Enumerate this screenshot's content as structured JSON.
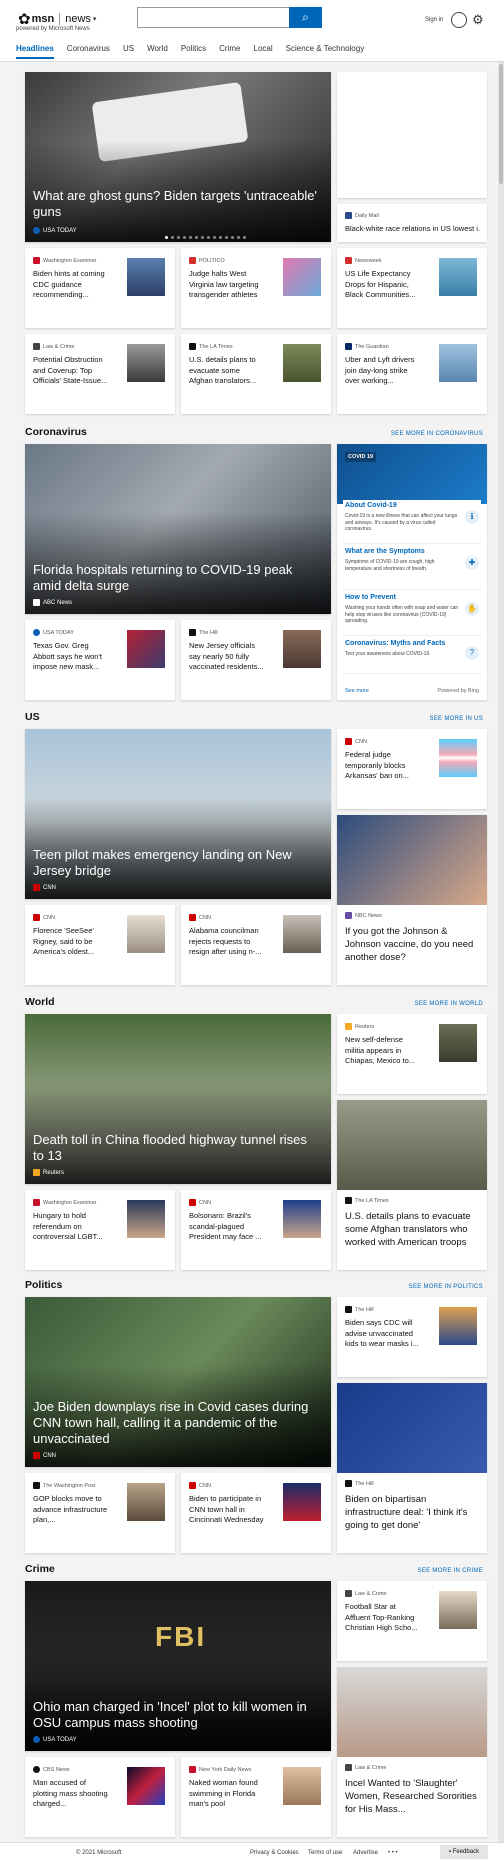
{
  "header": {
    "brand": "msn",
    "product": "news",
    "powered_by": "powered by Microsoft News",
    "search_placeholder": "",
    "sign_in": "Sign in"
  },
  "nav": [
    "Headlines",
    "Coronavirus",
    "US",
    "World",
    "Politics",
    "Crime",
    "Local",
    "Science & Technology"
  ],
  "top": {
    "hero": {
      "title": "What are ghost guns? Biden targets 'untraceable' guns",
      "source": "USA TODAY"
    },
    "side": {
      "source": "Daily Mail",
      "title": "Black-white race relations in US lowest i..."
    },
    "cards": [
      {
        "source": "Washington Examiner",
        "title": "Biden hints at coming CDC guidance recommending..."
      },
      {
        "source": "POLITICO",
        "title": "Judge halts West Virginia law targeting transgender athletes"
      },
      {
        "source": "Newsweek",
        "title": "US Life Expectancy Drops for Hispanic, Black Communities..."
      },
      {
        "source": "Law & Crime",
        "title": "Potential Obstruction and Coverup: Top Officials' State-Issue..."
      },
      {
        "source": "The LA Times",
        "title": "U.S. details plans to evacuate some Afghan translators..."
      },
      {
        "source": "The Guardian",
        "title": "Uber and Lyft drivers join day-long strike over working..."
      }
    ]
  },
  "coronavirus": {
    "heading": "Coronavirus",
    "more": "SEE MORE IN CORONAVIRUS",
    "hero": {
      "title": "Florida hospitals returning to COVID-19 peak amid delta surge",
      "source": "ABC News"
    },
    "cards": [
      {
        "source": "USA TODAY",
        "title": "Texas Gov. Greg Abbott says he won't impose new mask..."
      },
      {
        "source": "The Hill",
        "title": "New Jersey officials say nearly 50 fully vaccinated residents..."
      }
    ],
    "panel": {
      "label": "COVID 19",
      "items": [
        {
          "h": "About Covid-19",
          "d": "Covid-19 is a new illness that can affect your lungs and airways. It's caused by a virus called coronavirus."
        },
        {
          "h": "What are the Symptoms",
          "d": "Symptoms of COVID-19 are cough, high temperature and shortness of breath."
        },
        {
          "h": "How to Prevent",
          "d": "Washing your hands often with soap and water can help stop viruses like coronavirus (COVID-19) spreading."
        },
        {
          "h": "Coronavirus: Myths and Facts",
          "d": "Test your awareness about COVID-19."
        }
      ],
      "see_more": "See more",
      "powered": "Powered by Bing"
    }
  },
  "us": {
    "heading": "US",
    "more": "SEE MORE IN US",
    "hero": {
      "title": "Teen pilot makes emergency landing on New Jersey bridge",
      "source": "CNN"
    },
    "side": {
      "source": "CNN",
      "title": "Federal judge temporarily blocks Arkansas' ban on..."
    },
    "cards": [
      {
        "source": "CNN",
        "title": "Florence 'SeeSee' Rigney, said to be America's oldest..."
      },
      {
        "source": "CNN",
        "title": "Alabama councilman rejects requests to resign after using n-..."
      }
    ],
    "tall": {
      "source": "NBC News",
      "title": "If you got the Johnson & Johnson vaccine, do you need another dose?"
    }
  },
  "world": {
    "heading": "World",
    "more": "SEE MORE IN WORLD",
    "hero": {
      "title": "Death toll in China flooded highway tunnel rises to 13",
      "source": "Reuters"
    },
    "side": {
      "source": "Reuters",
      "title": "New self-defense militia appears in Chiapas, Mexico to..."
    },
    "cards": [
      {
        "source": "Washington Examiner",
        "title": "Hungary to hold referendum on controversial LGBT..."
      },
      {
        "source": "CNN",
        "title": "Bolsonaro: Brazil's scandal-plagued President may face ..."
      }
    ],
    "tall": {
      "source": "The LA Times",
      "title": "U.S. details plans to evacuate some Afghan translators who worked with American troops"
    }
  },
  "politics": {
    "heading": "Politics",
    "more": "SEE MORE IN POLITICS",
    "hero": {
      "title": "Joe Biden downplays rise in Covid cases during CNN town hall, calling it a pandemic of the unvaccinated",
      "source": "CNN"
    },
    "side": {
      "source": "The Hill",
      "title": "Biden says CDC will advise unvaccinated kids to wear masks i..."
    },
    "cards": [
      {
        "source": "The Washington Post",
        "title": "GOP blocks move to advance infrastructure plan,..."
      },
      {
        "source": "CNN",
        "title": "Biden to participate in CNN town hall in Cincinnati Wednesday"
      }
    ],
    "tall": {
      "source": "The Hill",
      "title": "Biden on bipartisan infrastructure deal: 'I think it's going to get done'"
    }
  },
  "crime": {
    "heading": "Crime",
    "more": "SEE MORE IN CRIME",
    "hero": {
      "title": "Ohio man charged in 'Incel' plot to kill women in OSU campus mass shooting",
      "source": "USA TODAY"
    },
    "side": {
      "source": "Law & Crime",
      "title": "Football Star at Affluent Top-Ranking Christian High Scho..."
    },
    "cards": [
      {
        "source": "CBS News",
        "title": "Man accused of plotting mass shooting charged..."
      },
      {
        "source": "New York Daily News",
        "title": "Naked woman found swimming in Florida man's pool"
      }
    ],
    "tall": {
      "source": "Law & Crime",
      "title": "Incel Wanted to 'Slaughter' Women, Researched Sororities for His Mass..."
    }
  },
  "footer": {
    "copyright": "© 2021 Microsoft",
    "privacy": "Privacy & Cookies",
    "terms": "Terms of use",
    "advertise": "Advertise",
    "more": "• • •",
    "feedback": "Feedback"
  }
}
